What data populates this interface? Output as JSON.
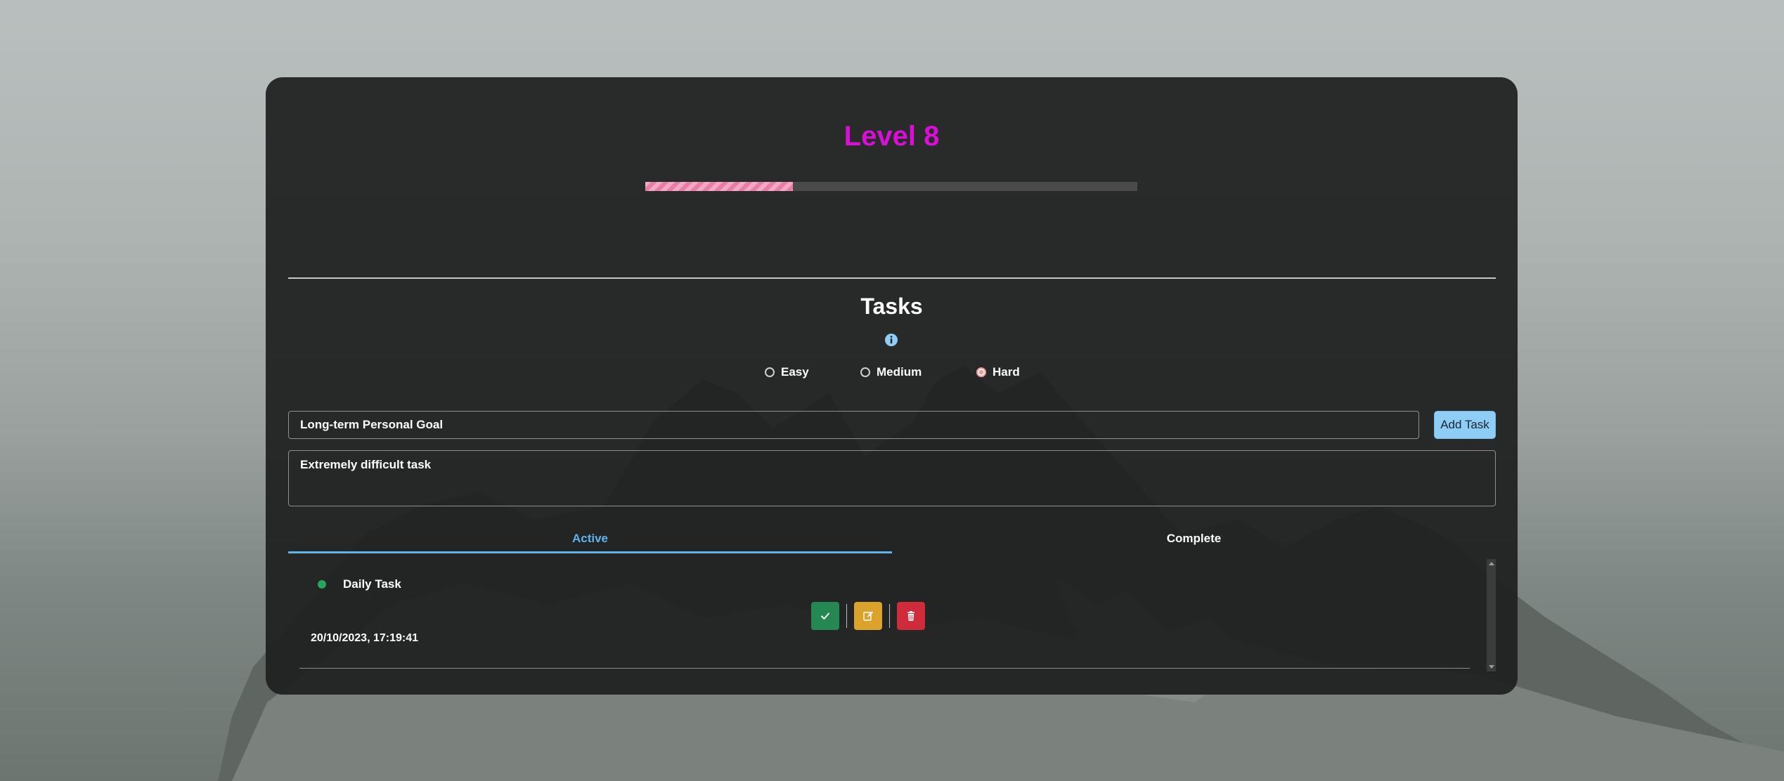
{
  "level": {
    "label": "Level 8",
    "progress": 0.3
  },
  "tasks_section": {
    "title": "Tasks",
    "info_icon": "info-circle-icon",
    "difficulty": {
      "options": [
        "Easy",
        "Medium",
        "Hard"
      ],
      "selected": "Hard"
    },
    "task_input_value": "Long-term Personal Goal",
    "add_button_label": "Add Task",
    "description_value": "Extremely difficult task"
  },
  "tabs": {
    "active_label": "Active",
    "complete_label": "Complete",
    "selected": "Active"
  },
  "task_list": [
    {
      "name": "Daily Task",
      "status_color": "#29a55c",
      "date": "20/10/2023, 17:19:41",
      "action_icons": [
        "check-icon",
        "edit-icon",
        "trash-icon"
      ]
    }
  ],
  "colors": {
    "level_title": "#d90fd6",
    "progress_fill": "#f4a7c6",
    "accent": "#5db4ee",
    "add_button": "#8ecdf6",
    "complete_button": "#258751",
    "edit_button": "#dca32c",
    "delete_button": "#cf2b3a"
  }
}
